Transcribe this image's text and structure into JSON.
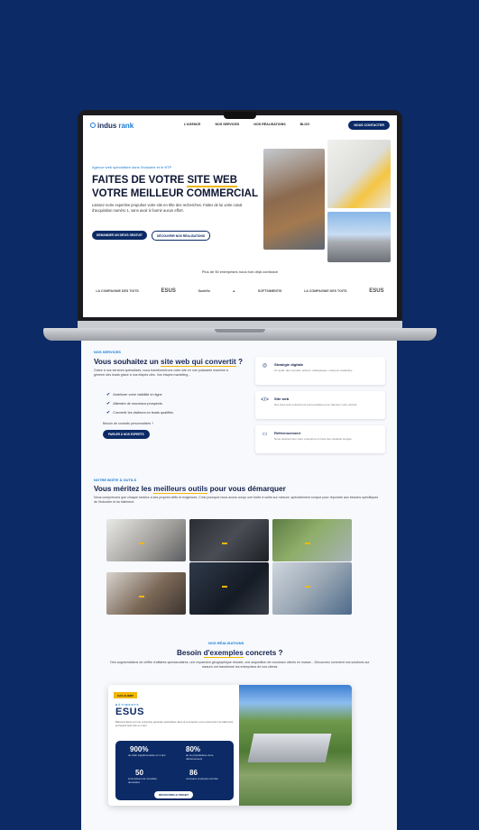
{
  "nav": {
    "logo_text": "indus",
    "logo_accent": "rank",
    "links": [
      "L'AGENCE",
      "NOS SERVICES",
      "NOS RÉALISATIONS",
      "BLOG"
    ],
    "cta": "NOUS CONTACTER"
  },
  "hero": {
    "tag": "Agence web spécialisée dans l'industrie et le BTP",
    "title_line1_pre": "FAITES DE VOTRE ",
    "title_line1_hl": "SITE WEB",
    "title_line2": "VOTRE MEILLEUR COMMERCIAL",
    "description": "Laissez notre expertise propulser votre site en tête des recherches. Faites de lui votre canal d'acquisition numéro 1, sans avoir à fournir aucun effort.",
    "btn_primary": "DEMANDER UN DEVIS GRATUIT",
    "btn_secondary": "DÉCOUVRIR NOS RÉALISATIONS"
  },
  "trust": {
    "text": "Plus de 50 entreprises nous font déjà confiance",
    "logos": [
      "LA COMPAGNIE DES TOITS",
      "ESUS",
      "Sudeflo",
      "",
      "SOFTSIMENTIS",
      "LA COMPAGNIE DES TOITS",
      "ESUS"
    ]
  },
  "services": {
    "kicker": "NOS SERVICES",
    "title_pre": "Vous souhaitez un ",
    "title_hl": "site web qui convertit",
    "title_post": " ?",
    "intro": "Grâce à nos services spécialisés, nous transformerons votre site en une puissante machine à générer des leads grâce à nos étapes clés. Vos étapes marketing...",
    "bullets": [
      "Améliorer votre visibilité en ligne",
      "Attendre de nouveaux prospects",
      "Convertir les visiteurs en leads qualifiés"
    ],
    "question": "Besoin de conseils personnalisés ?",
    "button": "PARLER À NOS EXPERTS",
    "cards": [
      {
        "icon": "target-icon",
        "title": "Stratégie digitale",
        "desc": "Un audit, des conseils, actions, stratégiques, missions marketing..."
      },
      {
        "icon": "code-icon",
        "title": "Site web",
        "desc": "Des sites web entièrement personnalisés pour valoriser votre activité."
      },
      {
        "icon": "monitor-icon",
        "title": "Référencement",
        "desc": "Nous positionnons votre entreprise en haut des résultats Google."
      }
    ]
  },
  "tools": {
    "kicker": "NOTRE BOÎTE À OUTILS",
    "title_pre": "Vous méritez les ",
    "title_hl": "meilleurs outils",
    "title_post": " pour vous démarquer",
    "desc": "Nous comprenons que chaque secteur a ses propres défis et exigences. C'est pourquoi nous avons conçu une boîte à outils sur mesure, spécialement conçue pour répondre aux besoins spécifiques de l'industrie et du bâtiment.",
    "tiles": [
      "",
      "",
      "",
      "",
      "",
      ""
    ]
  },
  "realisations": {
    "kicker": "NOS RÉALISATIONS",
    "title_pre": "Besoin ",
    "title_hl": "d'exemples",
    "title_post": " concrets ?",
    "desc": "Des augmentations de chiffre d'affaires spectaculaires, une expansion géographique réussie, une acquisition de nouveaux clients en masse... Découvrez comment nos solutions sur mesure ont transformé les entreprises de nos clients.",
    "case": {
      "tag": "CAS CLIENT",
      "logo_top": "BÂTIMENTS",
      "logo": "ESUS",
      "desc": "Bâtiment Esus est une entreprise générale spécialisée dans la conception et la construction de bâtiments professionnels clés en main.",
      "stats": [
        {
          "num": "900%",
          "label": "de trafic supplémentaire en 3 ans"
        },
        {
          "num": "80%",
          "label": "de ce propriétaires via le référencement"
        },
        {
          "num": "50",
          "label": "soumissions de nouvelles demandes"
        },
        {
          "num": "86",
          "label": "nouveaux employés recrutés"
        }
      ],
      "button": "DÉCOUVRIR LE PROJET"
    }
  }
}
